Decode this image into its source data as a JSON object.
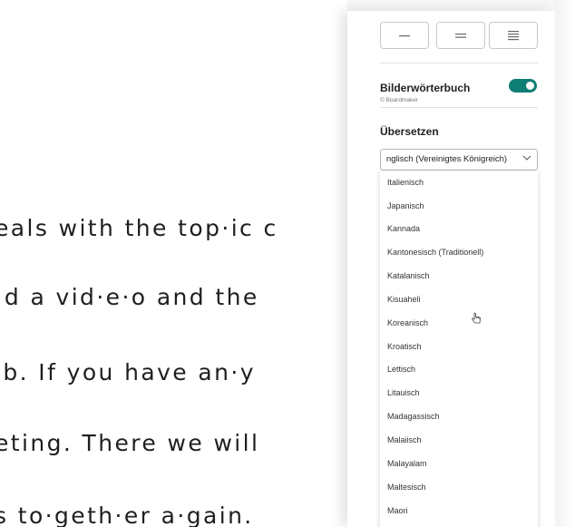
{
  "reader": {
    "lines": [
      "eals with the top·ic c",
      "ːd a vid·e·o and the",
      "ıb. If you have an·y",
      "eting. There we will",
      "s to·geth·er a·gain."
    ]
  },
  "panel": {
    "spacing_buttons": [
      {
        "icon": "line-spacing-narrow-icon"
      },
      {
        "icon": "line-spacing-medium-icon"
      },
      {
        "icon": "line-spacing-wide-icon"
      }
    ],
    "picture_dictionary": {
      "label": "Bilderwörterbuch",
      "sublabel": "© Boardmaker",
      "enabled": true
    },
    "translate": {
      "title": "Übersetzen",
      "selected": "nglisch (Vereinigtes Königreich)",
      "options": [
        "Italienisch",
        "Japanisch",
        "Kannada",
        "Kantonesisch (Traditionell)",
        "Katalanisch",
        "Kisuaheli",
        "Koreanisch",
        "Kroatisch",
        "Lettisch",
        "Litauisch",
        "Madagassisch",
        "Malaiisch",
        "Malayalam",
        "Maltesisch",
        "Maori"
      ]
    }
  },
  "colors": {
    "accent": "#0f7e74",
    "text": "#1f1f1f"
  }
}
